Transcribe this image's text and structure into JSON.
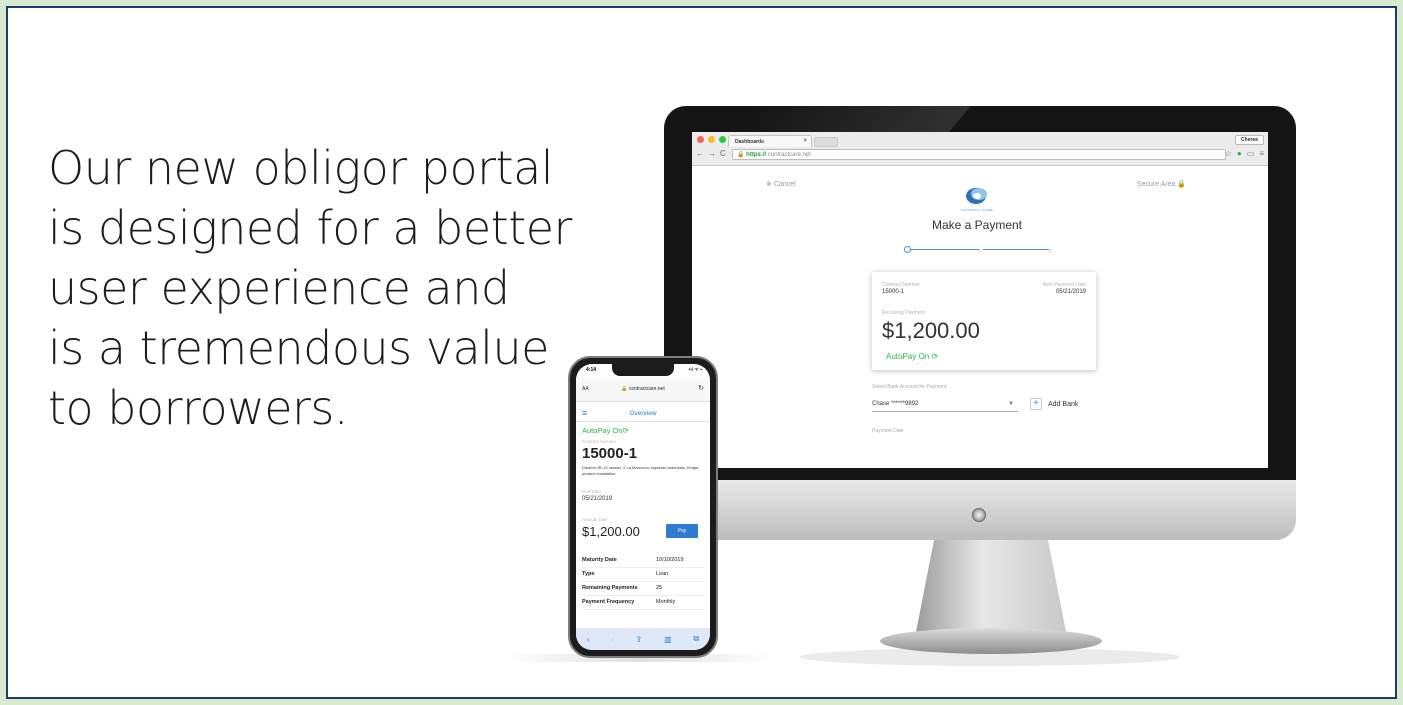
{
  "headline": [
    "Our new obligor portal",
    "is designed for a better",
    "user experience and",
    "is a tremendous value",
    "to borrowers."
  ],
  "desktop": {
    "browser": {
      "tab_title": "Dashboards",
      "tab_close": "×",
      "profile": "Cheree",
      "scheme": "https://",
      "url": "contractcare.net",
      "traffic_colors": [
        "#fc5f57",
        "#fdbc2e",
        "#28c840"
      ]
    },
    "page": {
      "cancel": "Cancel",
      "secure": "Secure Area",
      "brand": "CONTRACT CARE",
      "title": "Make a Payment",
      "steps": [
        "2",
        "3"
      ],
      "card": {
        "contract_label": "Contract Number",
        "contract_value": "15000-1",
        "next_label": "Next Payment Date",
        "next_value": "05/21/2019",
        "recurring_label": "Recurring Payment",
        "amount": "$1,200.00",
        "autopay": "AutoPay On"
      },
      "bank_label": "Select Bank Account for Payment",
      "bank_value": "Chase ******9892",
      "add_bank": "Add Bank",
      "payment_date_label": "Payment Date"
    }
  },
  "phone": {
    "time": "4:14",
    "signal": "•ıl ᯤ ▪",
    "aa": "AA",
    "address": "contractcare.net",
    "header_title": "Overview",
    "autopay": "AutoPay On",
    "contract_label": "Contract Number",
    "contract_value": "15000-1",
    "description": "Diedrich IR-12 roaster, 2 La Marzocco espresso machines, freight, product installation.",
    "due_label": "Due Date",
    "due_value": "05/21/2019",
    "amount_label": "Amount Due",
    "amount": "$1,200.00",
    "pay": "Pay",
    "rows": [
      {
        "k": "Maturity Date",
        "v": "10/10/2019"
      },
      {
        "k": "Type",
        "v": "Loan"
      },
      {
        "k": "Remaining Payments",
        "v": "25"
      },
      {
        "k": "Payment Frequency",
        "v": "Monthly"
      }
    ],
    "toolbar_icons": [
      "back-icon",
      "forward-icon",
      "share-icon",
      "bookmarks-icon",
      "tabs-icon"
    ]
  },
  "colors": {
    "accent_blue": "#2e7bd0",
    "autopay_green": "#2fb64a",
    "frame_border": "#1f3a6e",
    "background": "#d8ebd1"
  }
}
